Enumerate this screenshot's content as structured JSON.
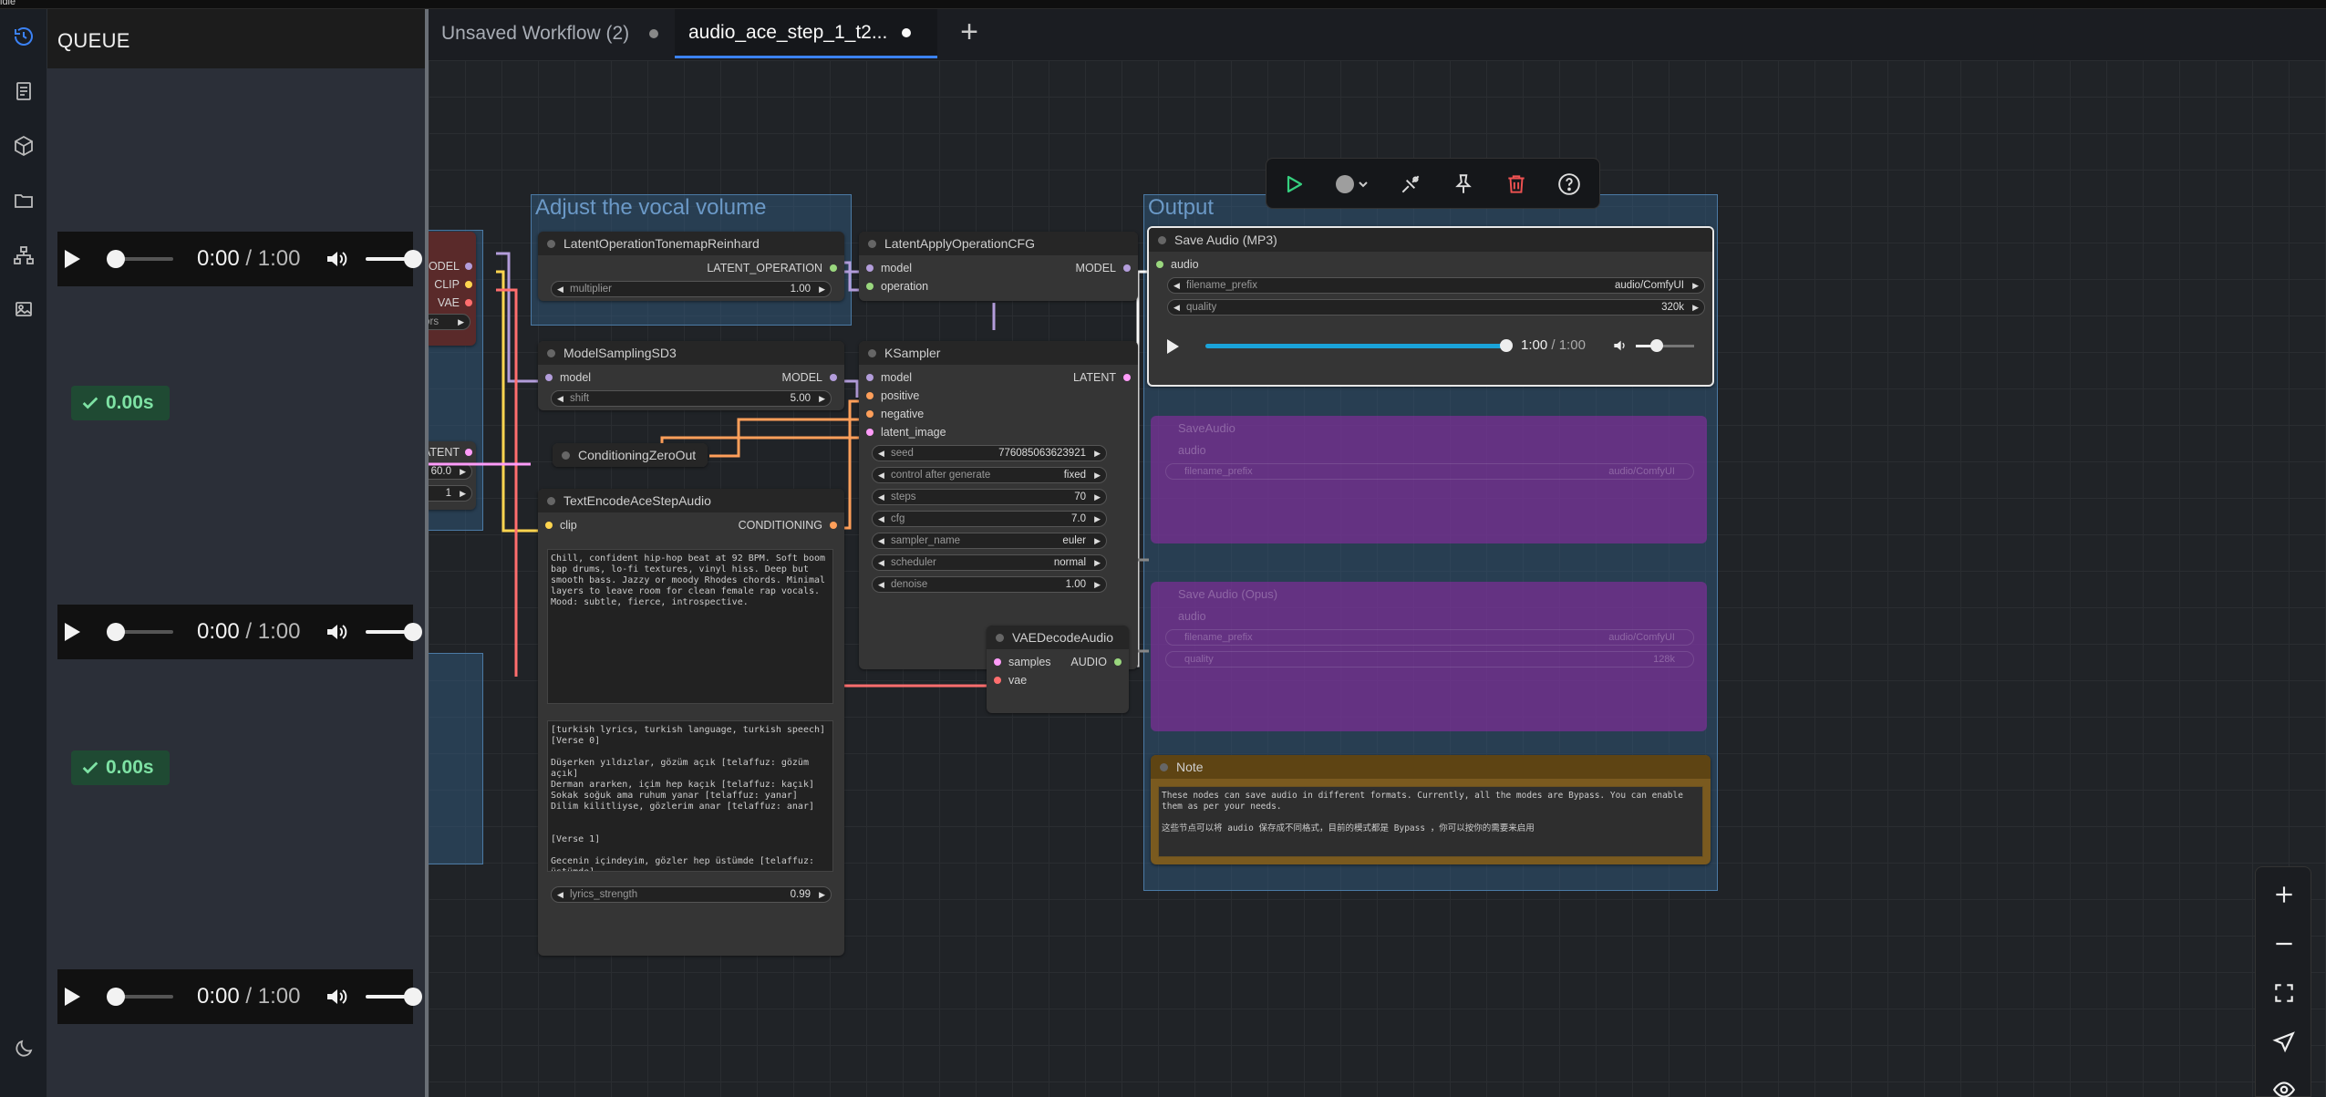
{
  "system": {
    "label": "idle"
  },
  "queue": {
    "title": "QUEUE",
    "items": [
      {
        "current": "0:00",
        "duration": "1:00"
      },
      {
        "current": "0:00",
        "duration": "1:00"
      },
      {
        "current": "0:00",
        "duration": "1:00"
      }
    ],
    "badges": [
      {
        "time": "0.00s"
      },
      {
        "time": "0.00s"
      }
    ]
  },
  "tabs": [
    {
      "label": "Unsaved Workflow (2)"
    },
    {
      "label": "audio_ace_step_1_t2..."
    }
  ],
  "groups": {
    "vocal": "Adjust the vocal volume",
    "output": "Output"
  },
  "nodes": {
    "partial_loader": {
      "out1": "MODEL",
      "out2": "CLIP",
      "out3": "VAE",
      "widget": "nsors"
    },
    "partial_latent": {
      "out": "LATENT",
      "w1": "60.0",
      "w2": "1"
    },
    "tonemap": {
      "title": "LatentOperationTonemapReinhard",
      "out": "LATENT_OPERATION",
      "w_label": "multiplier",
      "w_value": "1.00"
    },
    "cfgop": {
      "title": "LatentApplyOperationCFG",
      "in1": "model",
      "in2": "operation",
      "out": "MODEL"
    },
    "msd3": {
      "title": "ModelSamplingSD3",
      "in": "model",
      "out": "MODEL",
      "w_label": "shift",
      "w_value": "5.00"
    },
    "ksampler": {
      "title": "KSampler",
      "inputs": [
        "model",
        "positive",
        "negative",
        "latent_image"
      ],
      "out": "LATENT",
      "widgets": [
        {
          "label": "seed",
          "value": "776085063623921"
        },
        {
          "label": "control after generate",
          "value": "fixed"
        },
        {
          "label": "steps",
          "value": "70"
        },
        {
          "label": "cfg",
          "value": "7.0"
        },
        {
          "label": "sampler_name",
          "value": "euler"
        },
        {
          "label": "scheduler",
          "value": "normal"
        },
        {
          "label": "denoise",
          "value": "1.00"
        }
      ]
    },
    "czero": {
      "title": "ConditioningZeroOut"
    },
    "tenc": {
      "title": "TextEncodeAceStepAudio",
      "in": "clip",
      "out": "CONDITIONING",
      "tags": "Chill, confident hip-hop beat at 92 BPM. Soft boom bap drums, lo-fi textures, vinyl hiss. Deep but smooth bass. Jazzy or moody Rhodes chords. Minimal layers to leave room for clean female rap vocals. Mood: subtle, fierce, introspective.",
      "lyrics": "[turkish lyrics, turkish language, turkish speech]\n[Verse 0]\n\nDüşerken yıldızlar, gözüm açık [telaffuz: gözüm açık]\nDerman ararken, içim hep kaçık [telaffuz: kaçık]\nSokak soğuk ama ruhum yanar [telaffuz: yanar]\nDilim kilitliyse, gözlerim anar [telaffuz: anar]\n\n\n[Verse 1]\n\nGecenin içindeyim, gözler hep üstümde [telaffuz: üstümde]",
      "w_label": "lyrics_strength",
      "w_value": "0.99"
    },
    "vaedec": {
      "title": "VAEDecodeAudio",
      "in1": "samples",
      "in2": "vae",
      "out": "AUDIO"
    },
    "saveaudio_mp3": {
      "title": "Save Audio (MP3)",
      "in": "audio",
      "w1_label": "filename_prefix",
      "w1_value": "audio/ComfyUI",
      "w2_label": "quality",
      "w2_value": "320k",
      "player_time": "1:00",
      "player_duration": "1:00",
      "progress": 1.0
    },
    "saveaudio": {
      "title": "SaveAudio",
      "in": "audio",
      "w_label": "filename_prefix",
      "w_value": "audio/ComfyUI"
    },
    "saveaudio_opus": {
      "title": "Save Audio (Opus)",
      "in": "audio",
      "w1_label": "filename_prefix",
      "w1_value": "audio/ComfyUI",
      "w2_label": "quality",
      "w2_value": "128k"
    },
    "note": {
      "title": "Note",
      "text": "These nodes can save audio in different formats. Currently, all the modes are Bypass. You can enable them as per your needs.\n\n这些节点可以将 audio 保存成不同格式，目前的模式都是 Bypass ，你可以按你的需要来启用"
    }
  },
  "colors": {
    "accent": "#3b82f6",
    "bypass": "#9628aa",
    "note": "#7a5a1f",
    "success": "#7ee2a4"
  }
}
